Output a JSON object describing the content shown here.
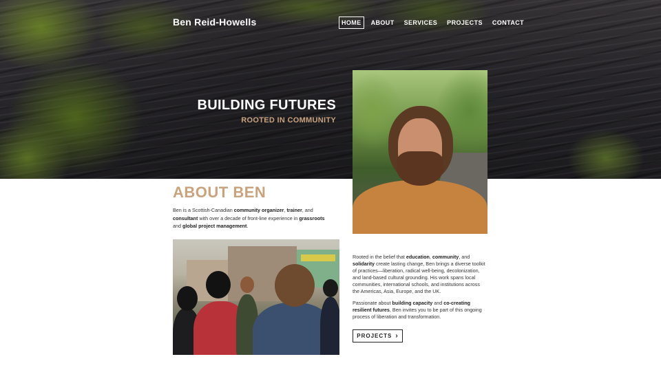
{
  "header": {
    "brand": "Ben Reid-Howells",
    "nav": [
      {
        "label": "HOME",
        "active": true
      },
      {
        "label": "ABOUT",
        "active": false
      },
      {
        "label": "SERVICES",
        "active": false
      },
      {
        "label": "PROJECTS",
        "active": false
      },
      {
        "label": "CONTACT",
        "active": false
      }
    ]
  },
  "hero": {
    "title": "BUILDING FUTURES",
    "subtitle": "ROOTED IN COMMUNITY"
  },
  "about": {
    "title": "ABOUT BEN",
    "intro": [
      {
        "t": "Ben is a Scottish-Canadian ",
        "b": false
      },
      {
        "t": "community organizer",
        "b": true
      },
      {
        "t": ", ",
        "b": false
      },
      {
        "t": "trainer",
        "b": true
      },
      {
        "t": ", and ",
        "b": false
      },
      {
        "t": "consultant",
        "b": true
      },
      {
        "t": " with over a decade of front-line experience in ",
        "b": false
      },
      {
        "t": "grassroots",
        "b": true
      },
      {
        "t": " and ",
        "b": false
      },
      {
        "t": "global project management",
        "b": true
      },
      {
        "t": ".",
        "b": false
      }
    ],
    "para1": [
      {
        "t": "Rooted in the belief that ",
        "b": false
      },
      {
        "t": "education",
        "b": true
      },
      {
        "t": ", ",
        "b": false
      },
      {
        "t": "community",
        "b": true
      },
      {
        "t": ", and ",
        "b": false
      },
      {
        "t": "solidarity",
        "b": true
      },
      {
        "t": " create lasting change, Ben brings a diverse toolkit of practices—liberation, radical well-being, decolonization, and land-based cultural grounding. His work spans local communities, international schools, and institutions across the Americas, Asia, Europe, and the UK.",
        "b": false
      }
    ],
    "para2": [
      {
        "t": "Passionate about ",
        "b": false
      },
      {
        "t": "building capacity",
        "b": true
      },
      {
        "t": " and ",
        "b": false
      },
      {
        "t": "co-creating resilient futures",
        "b": true
      },
      {
        "t": ", Ben invites you to be part of this ongoing process of liberation and transformation.",
        "b": false
      }
    ],
    "button_label": "PROJECTS",
    "button_icon": "chevron-right-icon"
  },
  "colors": {
    "accent": "#c9a27e",
    "text": "#333333",
    "background": "#ffffff"
  }
}
